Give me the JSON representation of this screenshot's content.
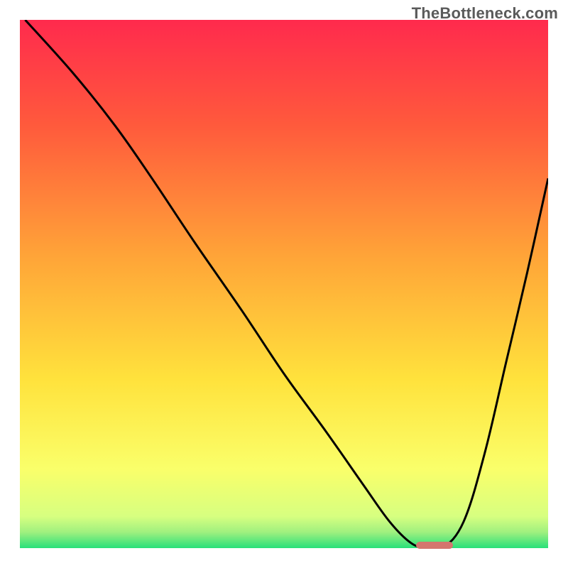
{
  "watermark": "TheBottleneck.com",
  "chart_data": {
    "type": "line",
    "title": "",
    "xlabel": "",
    "ylabel": "",
    "xlim": [
      0,
      100
    ],
    "ylim": [
      0,
      100
    ],
    "grid": false,
    "legend": false,
    "gradient_stops": [
      {
        "pos": 0,
        "color": "#ff2a4d"
      },
      {
        "pos": 20,
        "color": "#ff5a3c"
      },
      {
        "pos": 45,
        "color": "#ffa538"
      },
      {
        "pos": 68,
        "color": "#ffe23c"
      },
      {
        "pos": 85,
        "color": "#faff6a"
      },
      {
        "pos": 94,
        "color": "#d7ff80"
      },
      {
        "pos": 97,
        "color": "#9ff07f"
      },
      {
        "pos": 100,
        "color": "#28e07a"
      }
    ],
    "series": [
      {
        "name": "bottleneck-curve",
        "color": "#000000",
        "x": [
          1,
          10,
          18,
          25,
          33,
          42,
          50,
          58,
          65,
          70,
          74,
          77,
          80,
          84,
          88,
          92,
          96,
          100
        ],
        "y": [
          100,
          90,
          80,
          70,
          58,
          45,
          33,
          22,
          12,
          5,
          1,
          0,
          0,
          5,
          18,
          35,
          52,
          70
        ]
      }
    ],
    "marker": {
      "color": "#d4766e",
      "x_start": 75,
      "x_end": 82,
      "y": 0.5
    }
  }
}
